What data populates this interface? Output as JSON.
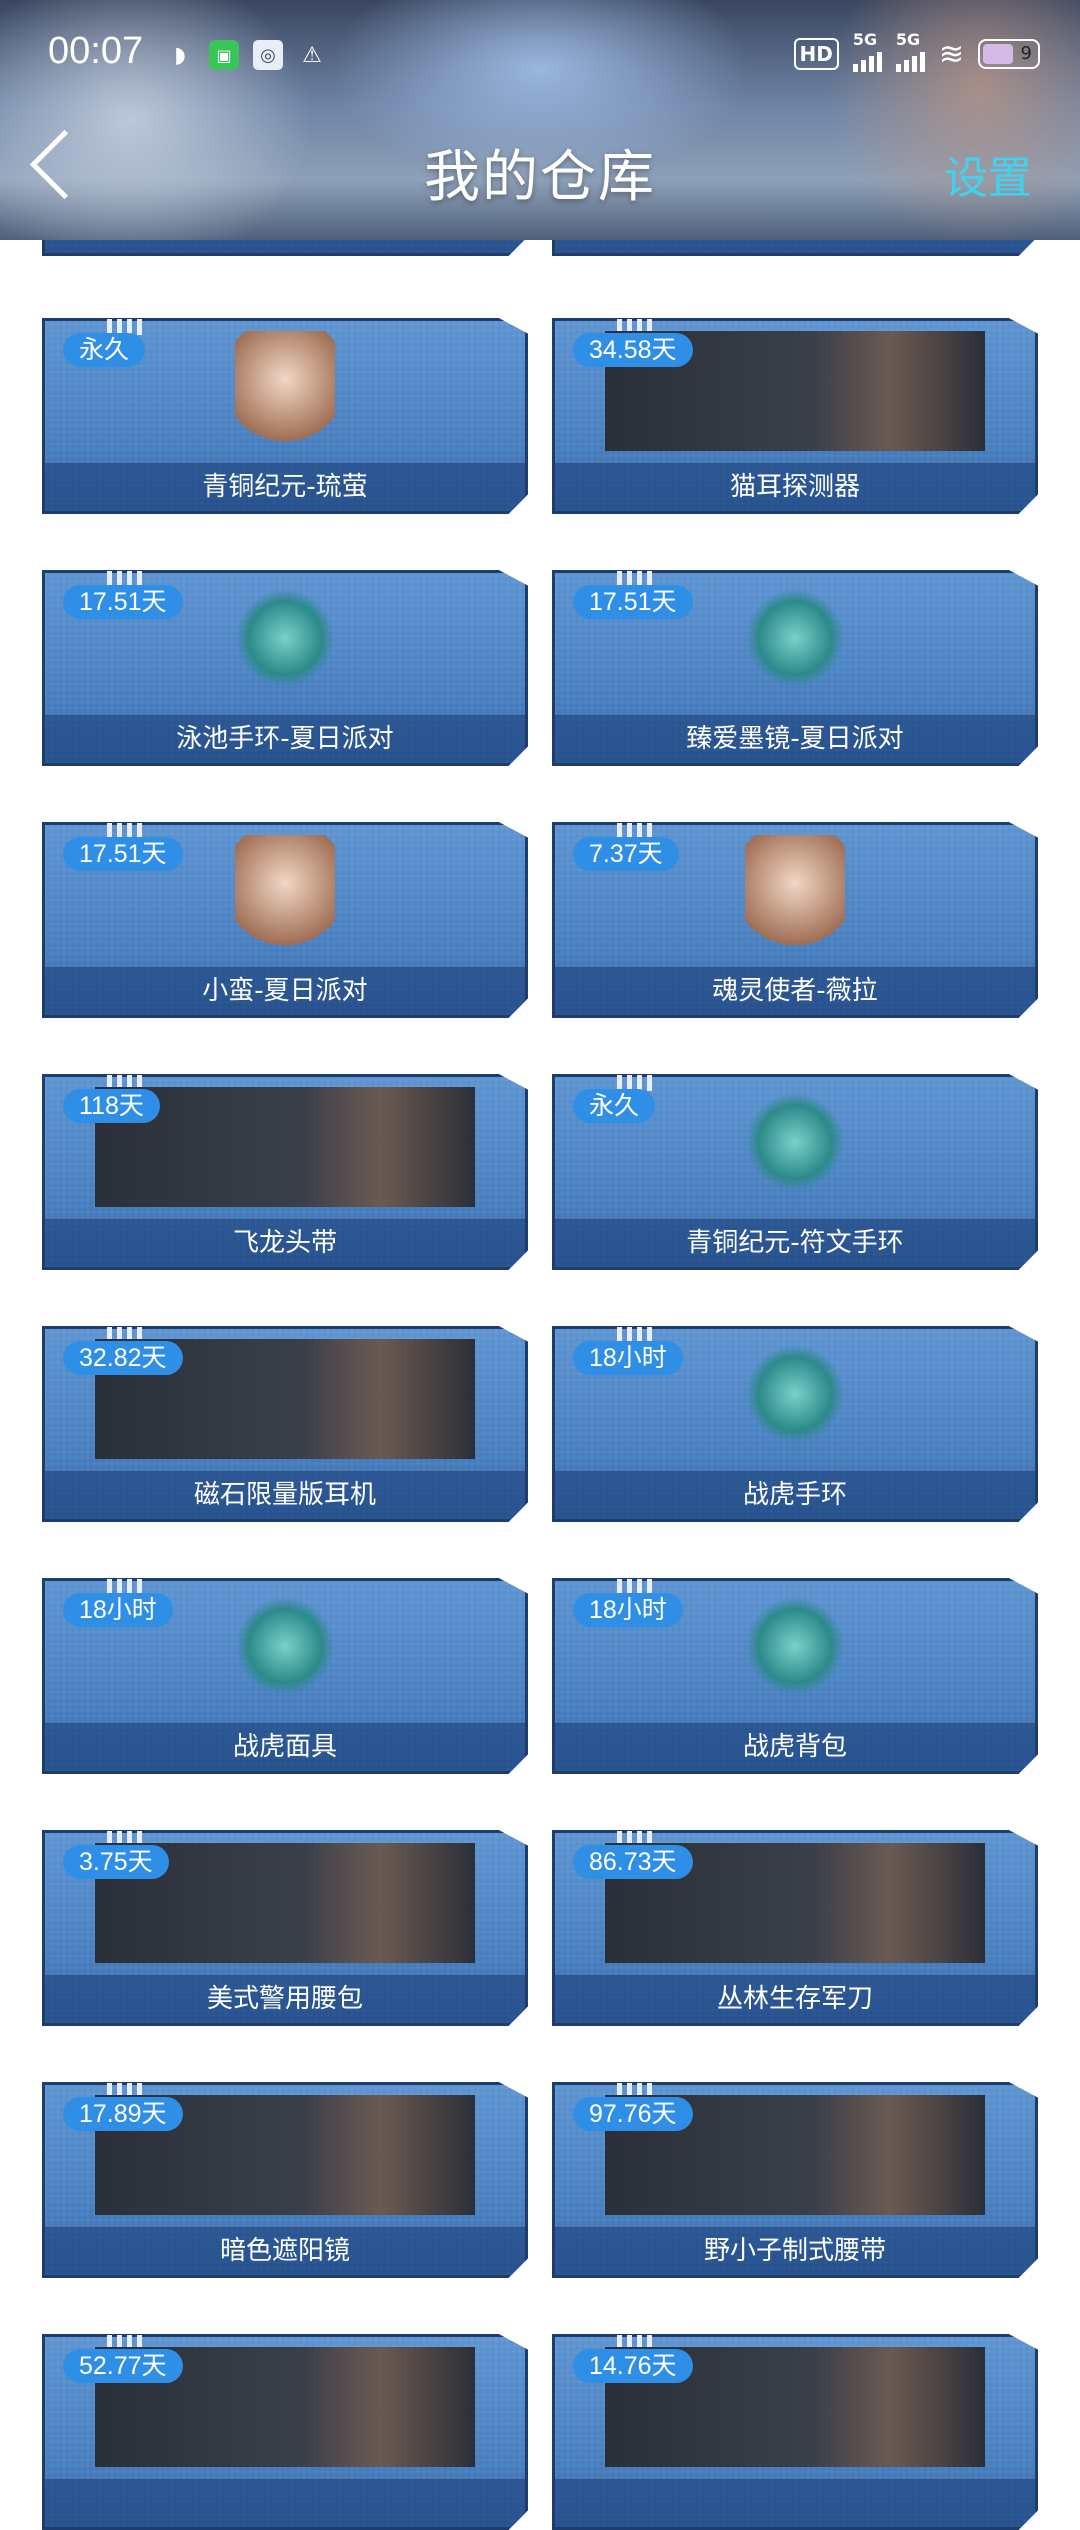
{
  "status_bar": {
    "time": "00:07",
    "icons": [
      "qq-icon",
      "android-icon",
      "app-icon",
      "warning-icon"
    ],
    "hd": "HD",
    "signal1": "5G",
    "signal2": "5G",
    "battery": "9"
  },
  "header": {
    "title": "我的仓库",
    "settings": "设置"
  },
  "items": [
    {
      "badge": "永久",
      "name": "青铜纪元-琉萤",
      "image": "character"
    },
    {
      "badge": "34.58天",
      "name": "猫耳探测器",
      "image": "wide"
    },
    {
      "badge": "17.51天",
      "name": "泳池手环-夏日派对",
      "image": "accessory"
    },
    {
      "badge": "17.51天",
      "name": "臻爱墨镜-夏日派对",
      "image": "accessory"
    },
    {
      "badge": "17.51天",
      "name": "小蛮-夏日派对",
      "image": "character"
    },
    {
      "badge": "7.37天",
      "name": "魂灵使者-薇拉",
      "image": "character"
    },
    {
      "badge": "118天",
      "name": "飞龙头带",
      "image": "wide"
    },
    {
      "badge": "永久",
      "name": "青铜纪元-符文手环",
      "image": "accessory"
    },
    {
      "badge": "32.82天",
      "name": "磁石限量版耳机",
      "image": "wide"
    },
    {
      "badge": "18小时",
      "name": "战虎手环",
      "image": "accessory"
    },
    {
      "badge": "18小时",
      "name": "战虎面具",
      "image": "accessory"
    },
    {
      "badge": "18小时",
      "name": "战虎背包",
      "image": "accessory"
    },
    {
      "badge": "3.75天",
      "name": "美式警用腰包",
      "image": "wide"
    },
    {
      "badge": "86.73天",
      "name": "丛林生存军刀",
      "image": "wide"
    },
    {
      "badge": "17.89天",
      "name": "暗色遮阳镜",
      "image": "wide"
    },
    {
      "badge": "97.76天",
      "name": "野小子制式腰带",
      "image": "wide"
    },
    {
      "badge": "52.77天",
      "name": "",
      "image": "wide"
    },
    {
      "badge": "14.76天",
      "name": "",
      "image": "wide"
    }
  ]
}
